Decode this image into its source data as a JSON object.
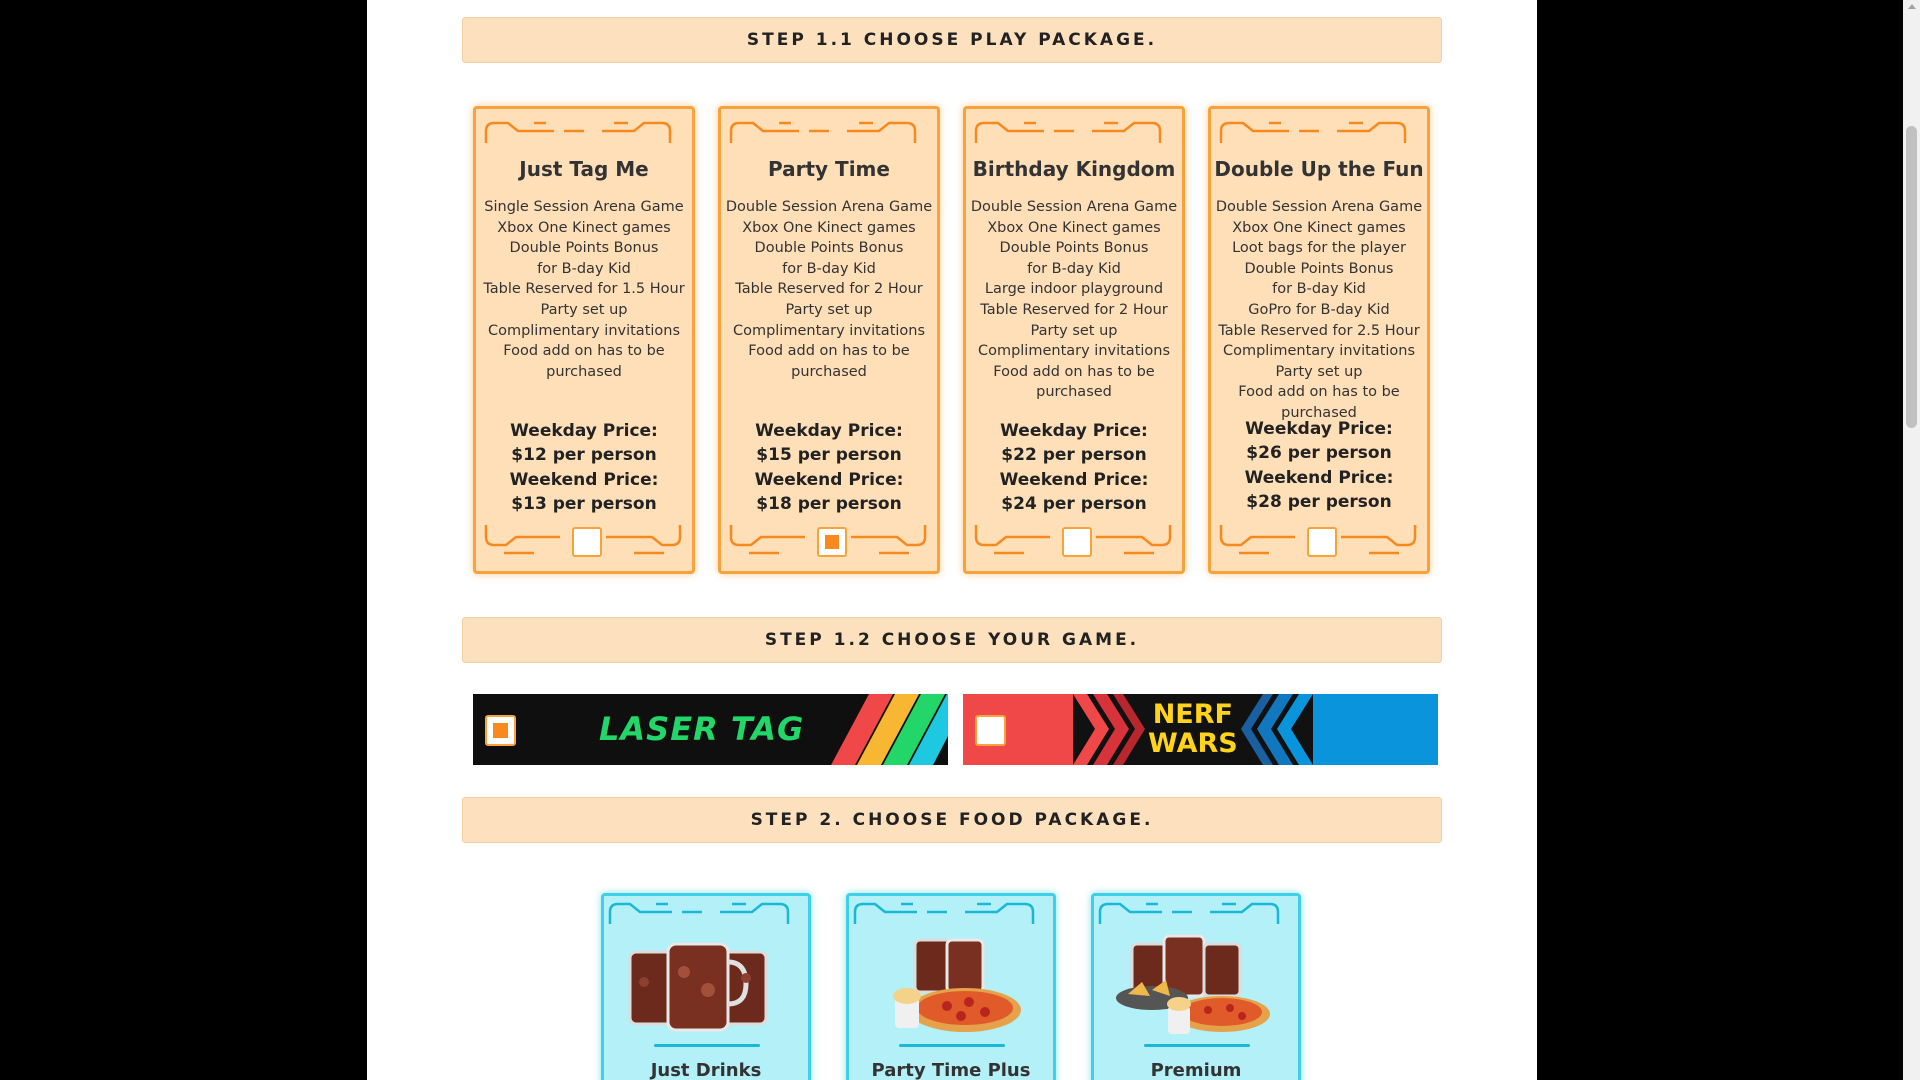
{
  "steps": {
    "step1_1": "STEP 1.1 CHOOSE PLAY PACKAGE.",
    "step1_2": "STEP 1.2 CHOOSE YOUR GAME.",
    "step2": "STEP 2. CHOOSE FOOD PACKAGE."
  },
  "play_packages": [
    {
      "title": "Just Tag Me",
      "features": "Single Session Arena Game\nXbox One Kinect games\nDouble Points Bonus\nfor B-day Kid\nTable Reserved for 1.5 Hour\nParty set up\nComplimentary invitations\nFood add on has to be\npurchased",
      "weekday_label": "Weekday Price:",
      "weekday_price": "$12 per person",
      "weekend_label": "Weekend Price:",
      "weekend_price": "$13 per person",
      "selected": false
    },
    {
      "title": "Party Time",
      "features": "Double Session Arena Game\nXbox One Kinect games\nDouble Points Bonus\nfor B-day Kid\nTable Reserved for 2 Hour\nParty set up\nComplimentary invitations\nFood add on has to be\npurchased",
      "weekday_label": "Weekday Price:",
      "weekday_price": "$15 per person",
      "weekend_label": "Weekend Price:",
      "weekend_price": "$18 per person",
      "selected": true
    },
    {
      "title": "Birthday Kingdom",
      "features": "Double Session Arena Game\nXbox One Kinect games\nDouble Points Bonus\nfor B-day Kid\nLarge indoor playground\nTable Reserved for 2 Hour\nParty set up\nComplimentary invitations\nFood add on has to be\npurchased",
      "weekday_label": "Weekday Price:",
      "weekday_price": "$22 per person",
      "weekend_label": "Weekend Price:",
      "weekend_price": "$24 per person",
      "selected": false
    },
    {
      "title": "Double Up the Fun",
      "features": "Double Session Arena Game\nXbox One Kinect games\nLoot bags for the player\nDouble Points Bonus\nfor B-day Kid\nGoPro for B-day Kid\nTable Reserved for 2.5 Hour\nComplimentary invitations\nParty set up\nFood add on has to be\npurchased",
      "weekday_label": "Weekday Price:",
      "weekday_price": "$26 per person",
      "weekend_label": "Weekend Price:",
      "weekend_price": "$28 per person",
      "selected": false
    }
  ],
  "games": [
    {
      "name": "LASER TAG",
      "selected": true
    },
    {
      "name_line1": "NERF",
      "name_line2": "WARS",
      "selected": false
    }
  ],
  "food_packages": [
    {
      "title": "Just Drinks"
    },
    {
      "title": "Party Time Plus"
    },
    {
      "title": "Premium"
    }
  ],
  "colors": {
    "orange_accent": "#f7a23a",
    "peach_bg": "#ffdfb8",
    "cyan_accent": "#3fd0e8",
    "cyan_bg": "#b3f0f7",
    "laser_green": "#22d66a",
    "nerf_red": "#f04848",
    "nerf_blue": "#0a94dc",
    "nerf_yellow": "#ffd41a"
  }
}
